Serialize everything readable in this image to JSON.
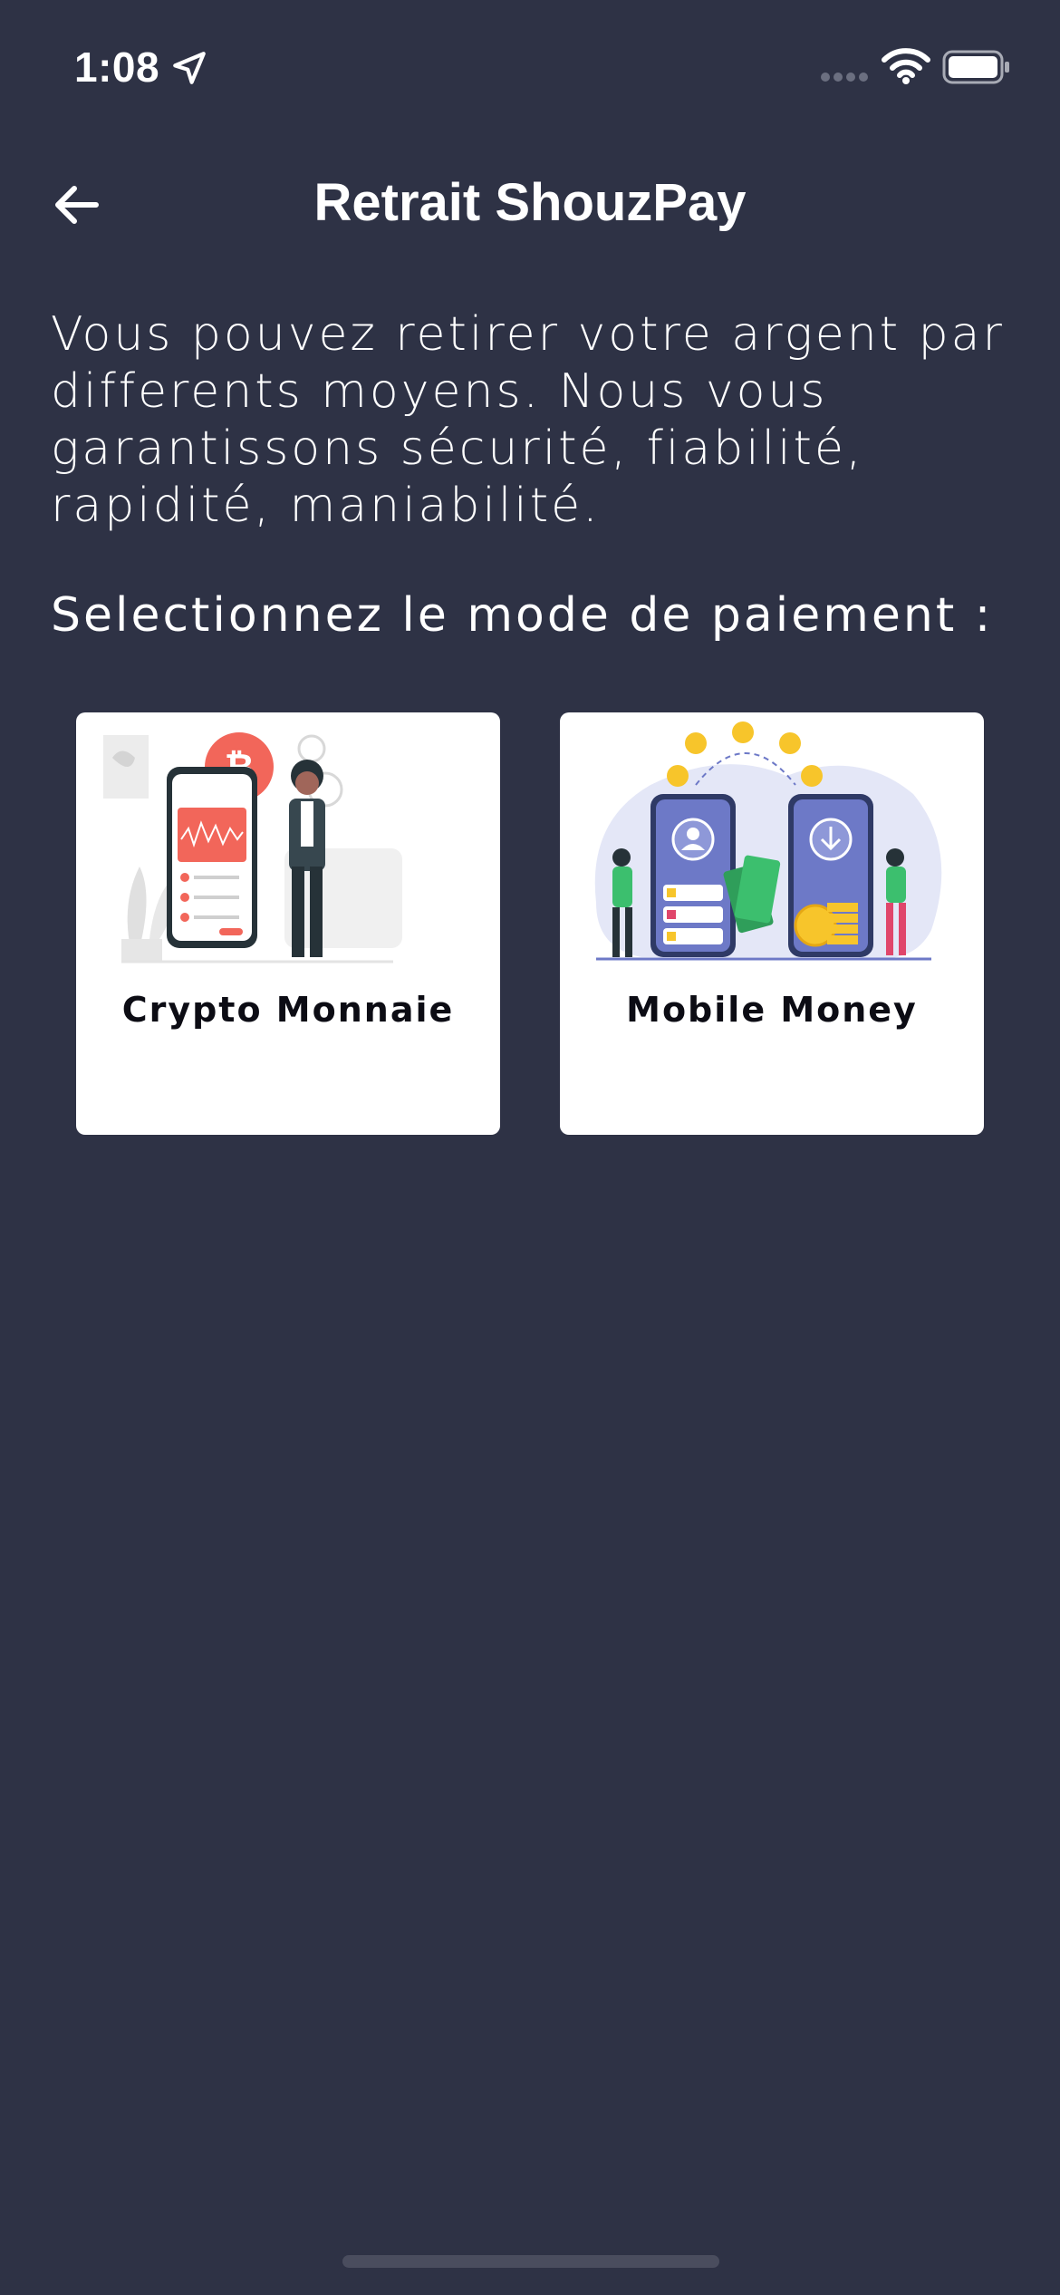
{
  "status_bar": {
    "time": "1:08",
    "icons": [
      "location-arrow-icon",
      "cellular-signal-icon",
      "wifi-icon",
      "battery-icon"
    ]
  },
  "header": {
    "title": "Retrait ShouzPay",
    "back_icon": "arrow-left-icon"
  },
  "main": {
    "description": "Vous pouvez retirer votre argent par differents moyens. Nous vous garantissons sécurité, fiabilité, rapidité, maniabilité.",
    "select_label": "Selectionnez le mode de paiement :",
    "options": [
      {
        "label": "Crypto Monnaie",
        "illustration": "crypto-portfolio-illustration"
      },
      {
        "label": "Mobile Money",
        "illustration": "mobile-money-transfer-illustration"
      }
    ]
  },
  "colors": {
    "background": "#2e3245",
    "card": "#ffffff",
    "accent_red": "#f2665a",
    "accent_blue": "#6d79c7",
    "coin_yellow": "#f7c52b"
  }
}
